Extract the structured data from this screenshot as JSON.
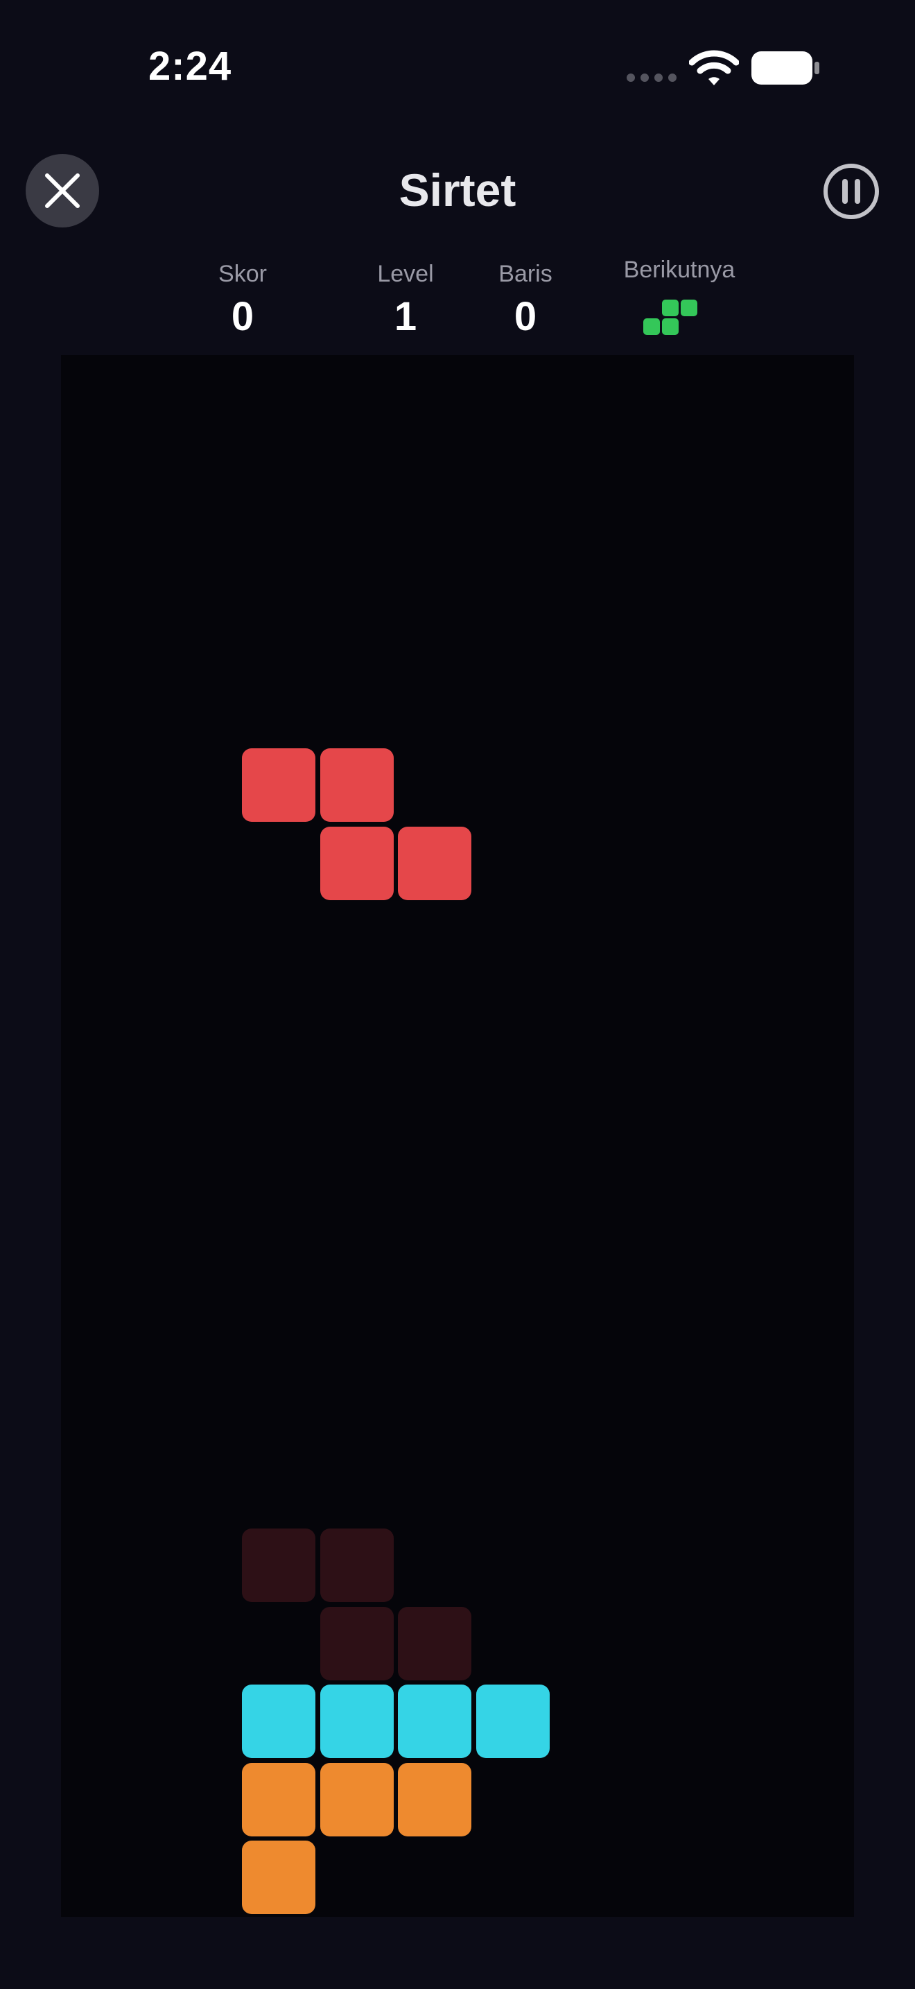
{
  "status_bar": {
    "time": "2:24"
  },
  "header": {
    "title": "Sirtet"
  },
  "stats": [
    {
      "label": "Skor",
      "value": "0"
    },
    {
      "label": "Level",
      "value": "1"
    },
    {
      "label": "Baris",
      "value": "0"
    }
  ],
  "next": {
    "label": "Berikutnya",
    "piece": "S",
    "color": "#34c759"
  },
  "colors": {
    "background": "#0c0c17",
    "board": "#05050a",
    "Z": "#e5474a",
    "ghost": "#2d1016",
    "I": "#35d4e6",
    "L": "#ee8a2f"
  },
  "board": {
    "columns": 10,
    "active_piece": {
      "type": "Z",
      "cells": [
        [
          3,
          5
        ],
        [
          4,
          5
        ],
        [
          4,
          6
        ],
        [
          5,
          6
        ]
      ]
    },
    "ghost_piece": {
      "type": "Z",
      "cells": [
        [
          3,
          15
        ],
        [
          4,
          15
        ],
        [
          4,
          16
        ],
        [
          5,
          16
        ]
      ]
    },
    "locked": [
      {
        "type": "I",
        "cells": [
          [
            3,
            17
          ],
          [
            4,
            17
          ],
          [
            5,
            17
          ],
          [
            6,
            17
          ]
        ]
      },
      {
        "type": "L",
        "cells": [
          [
            3,
            18
          ],
          [
            4,
            18
          ],
          [
            5,
            18
          ],
          [
            3,
            19
          ]
        ]
      }
    ]
  }
}
